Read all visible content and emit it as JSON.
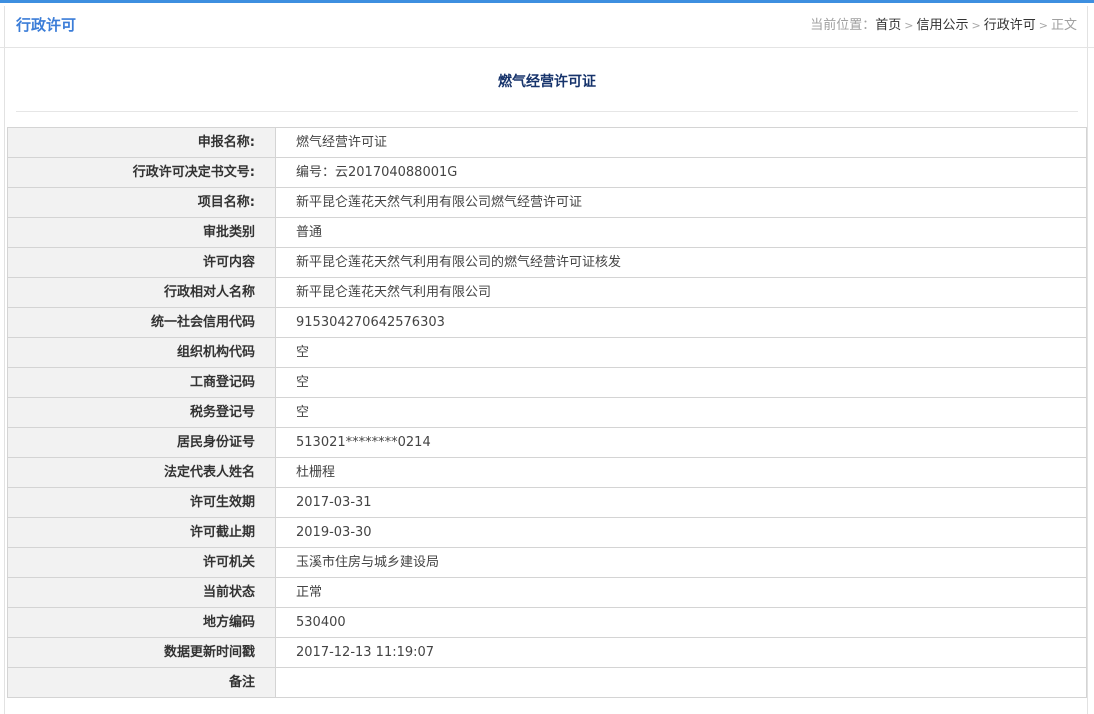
{
  "header": {
    "section_title": "行政许可",
    "breadcrumb": {
      "label": "当前位置：",
      "items": [
        "首页",
        "信用公示",
        "行政许可"
      ],
      "current": "正文",
      "separator": ">"
    }
  },
  "document": {
    "title": "燃气经营许可证"
  },
  "table": {
    "rows": [
      {
        "label": "申报名称:",
        "value": "燃气经营许可证"
      },
      {
        "label": "行政许可决定书文号:",
        "value": "编号：云201704088001G"
      },
      {
        "label": "项目名称:",
        "value": "新平昆仑莲花天然气利用有限公司燃气经营许可证"
      },
      {
        "label": "审批类别",
        "value": "普通"
      },
      {
        "label": "许可内容",
        "value": "新平昆仑莲花天然气利用有限公司的燃气经营许可证核发"
      },
      {
        "label": "行政相对人名称",
        "value": "新平昆仑莲花天然气利用有限公司"
      },
      {
        "label": "统一社会信用代码",
        "value": "915304270642576303"
      },
      {
        "label": "组织机构代码",
        "value": "空"
      },
      {
        "label": "工商登记码",
        "value": "空"
      },
      {
        "label": "税务登记号",
        "value": "空"
      },
      {
        "label": "居民身份证号",
        "value": "513021********0214"
      },
      {
        "label": "法定代表人姓名",
        "value": "杜栅程"
      },
      {
        "label": "许可生效期",
        "value": "2017-03-31"
      },
      {
        "label": "许可截止期",
        "value": "2019-03-30"
      },
      {
        "label": "许可机关",
        "value": "玉溪市住房与城乡建设局"
      },
      {
        "label": "当前状态",
        "value": "正常"
      },
      {
        "label": "地方编码",
        "value": "530400"
      },
      {
        "label": "数据更新时间戳",
        "value": "2017-12-13 11:19:07"
      },
      {
        "label": "备注",
        "value": ""
      }
    ]
  },
  "colors": {
    "accent": "#3d8fe0",
    "section_title": "#3b7dd8",
    "doc_title": "#16336b",
    "label_bg": "#f2f2f2",
    "border": "#d4d4d4"
  }
}
